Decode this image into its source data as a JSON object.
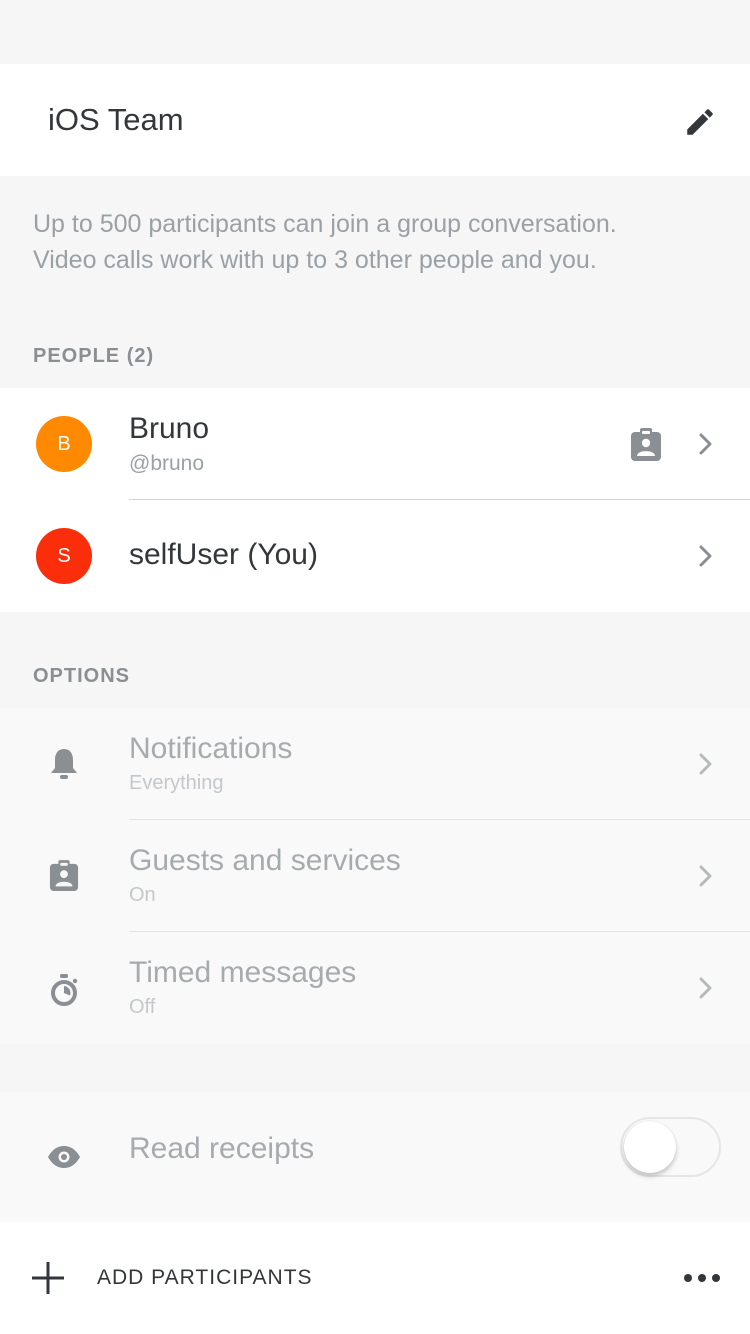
{
  "header": {
    "title": "iOS Team",
    "edit_icon": "pencil-icon"
  },
  "info": {
    "line1": "Up to 500 participants can join a group conversation.",
    "line2": "Video calls work with up to 3 other people and you."
  },
  "people": {
    "label": "PEOPLE (2)",
    "items": [
      {
        "initial": "B",
        "name": "Bruno",
        "handle": "@bruno",
        "avatar_color": "#ff8900",
        "badge_icon": "guest-badge-icon"
      },
      {
        "initial": "S",
        "name": "selfUser (You)",
        "handle": "",
        "avatar_color": "#fb2e0b"
      }
    ]
  },
  "options": {
    "label": "OPTIONS",
    "items": [
      {
        "title": "Notifications",
        "subtitle": "Everything",
        "icon": "bell-icon"
      },
      {
        "title": "Guests and services",
        "subtitle": "On",
        "icon": "guest-badge-icon"
      },
      {
        "title": "Timed messages",
        "subtitle": "Off",
        "icon": "timer-icon"
      }
    ]
  },
  "receipts": {
    "label": "Read receipts",
    "enabled": false,
    "icon": "eye-icon"
  },
  "footer": {
    "add_label": "ADD PARTICIPANTS",
    "add_icon": "plus-icon",
    "more_icon": "more-dots-icon"
  },
  "colors": {
    "background": "#f6f6f6",
    "text": "#33373a",
    "muted": "#9aa1a6"
  }
}
